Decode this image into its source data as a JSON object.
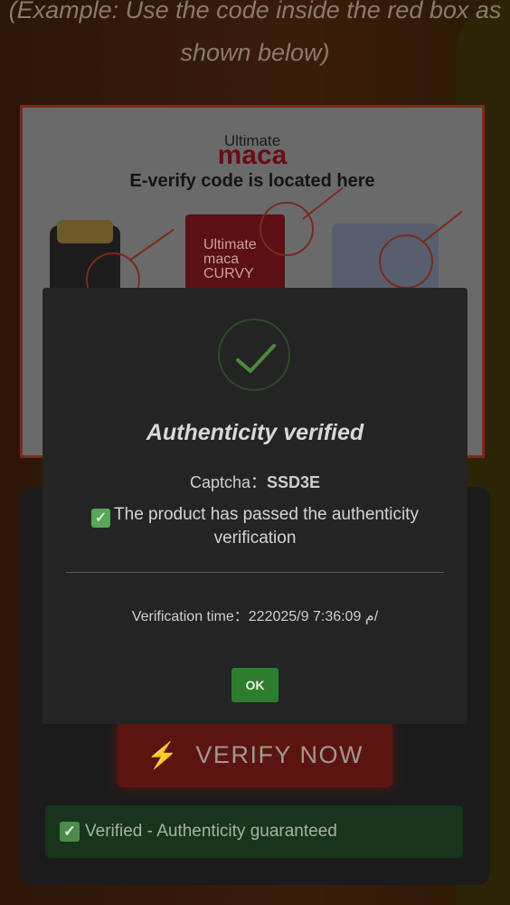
{
  "page": {
    "example_text": "(Example: Use the code inside the red box as shown below)"
  },
  "example_image": {
    "brand_top": "Ultimate",
    "brand_main": "maca",
    "heading": "E-verify code is located here",
    "pouch_label": "Ultimate\nmaca\nCURVY"
  },
  "modal": {
    "title": "Authenticity verified",
    "captcha_label": "Captcha：",
    "captcha_code": "SSD3E",
    "passed_message": "The product has passed the authenticity verification",
    "time_label": "Verification time：",
    "time_value": "22م 7:36:09 2025/9/",
    "ok_label": "OK"
  },
  "verify": {
    "button_label": "VERIFY NOW",
    "status_text": "Verified - Authenticity guaranteed"
  },
  "icons": {
    "success": "checkmark-icon",
    "bolt": "lightning-bolt-icon",
    "check_box": "check-box-icon"
  },
  "colors": {
    "accent_green": "#2e7d2e",
    "verify_red": "#5c1410",
    "frame_red": "#7a2a1e"
  }
}
